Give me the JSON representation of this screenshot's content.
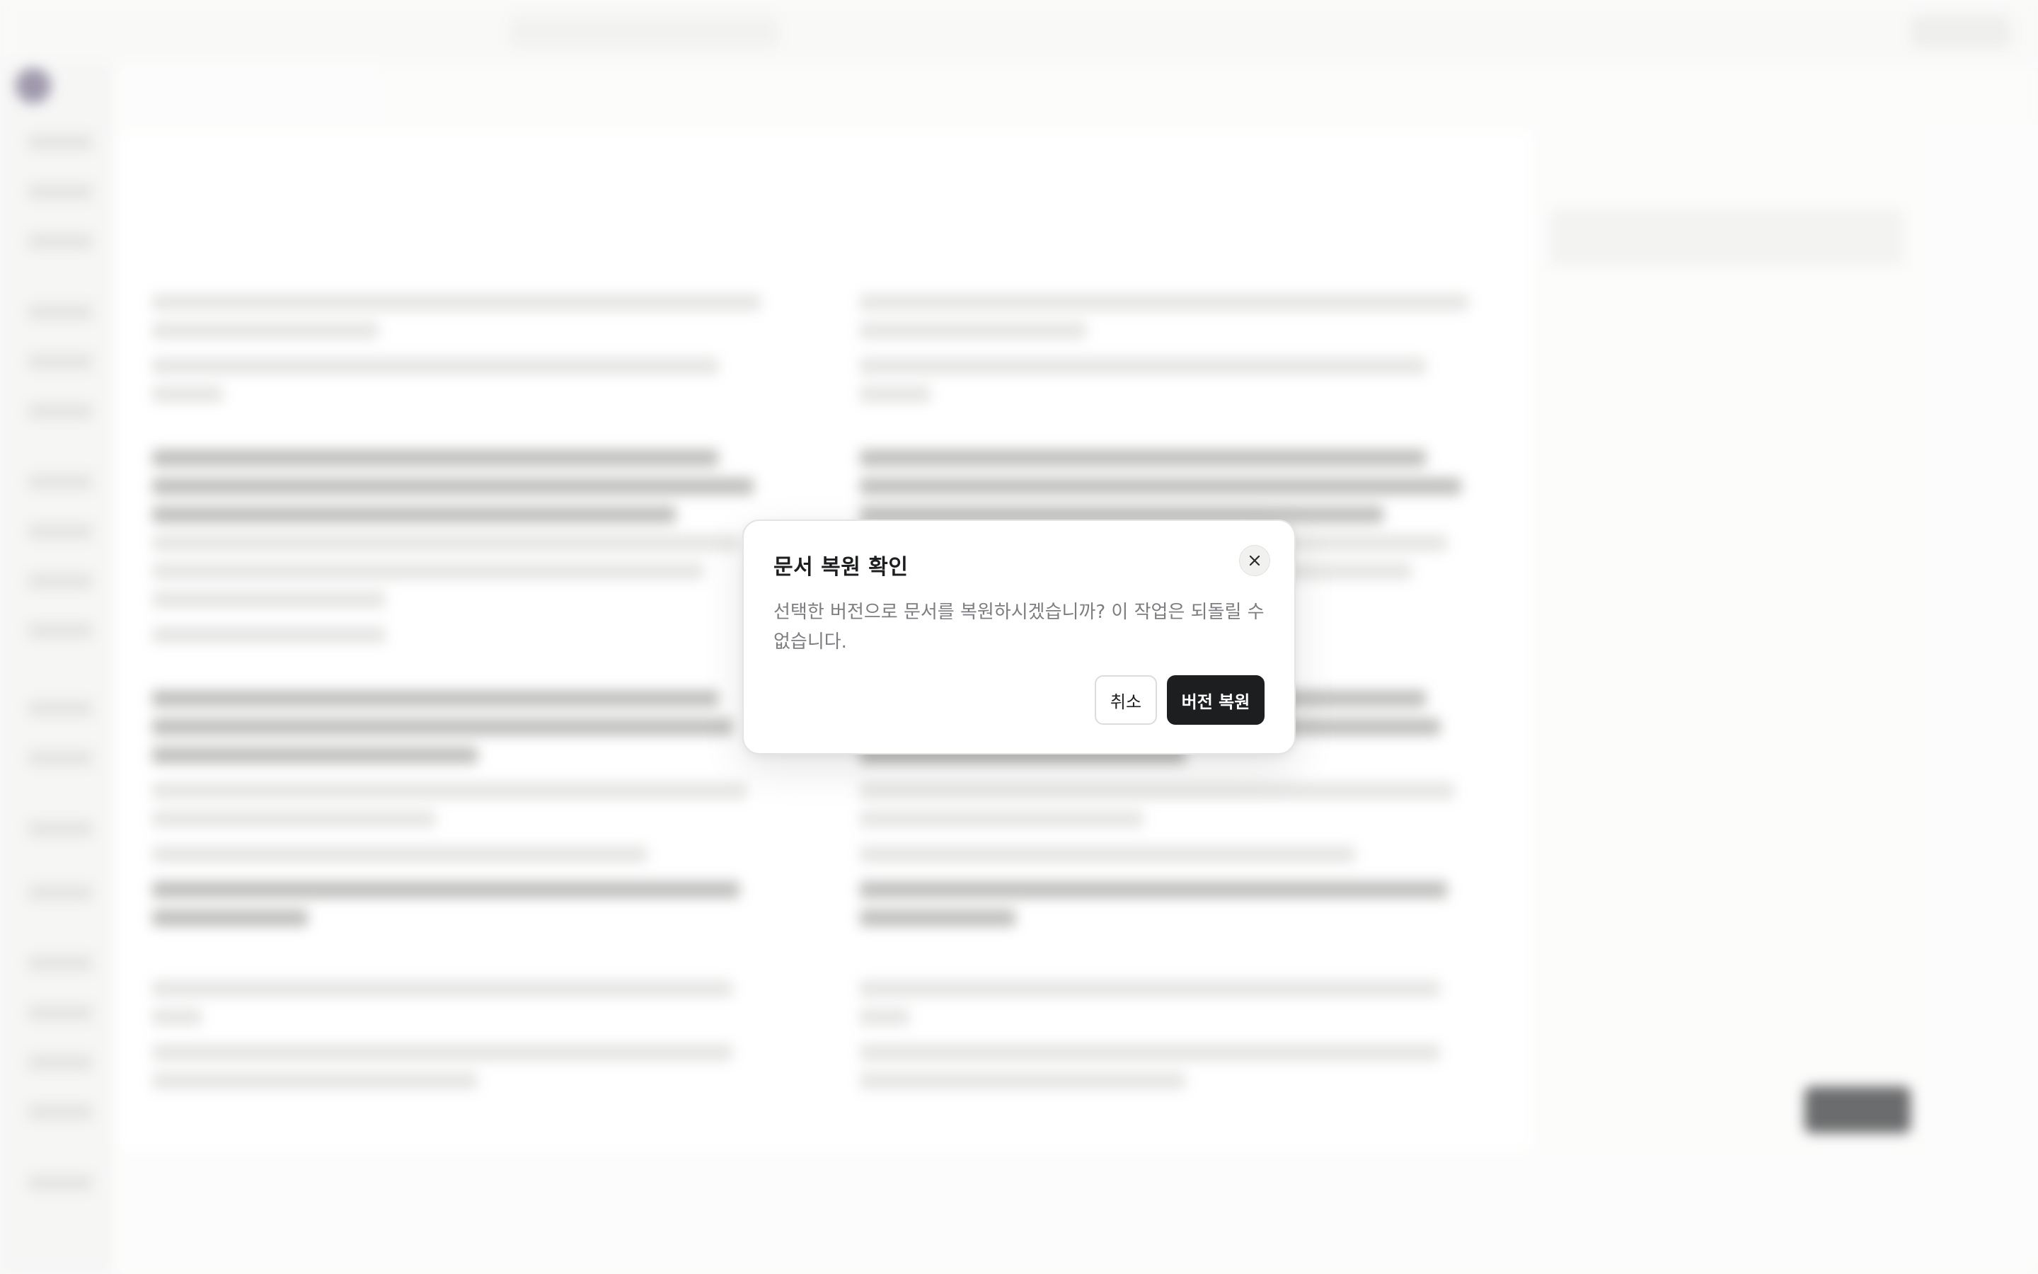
{
  "dialog": {
    "title": "문서 복원 확인",
    "message": "선택한 버전으로 문서를 복원하시겠습니까? 이 작업은 되돌릴 수 없습니다.",
    "cancel_label": "취소",
    "confirm_label": "버전 복원",
    "close_icon": "close-icon"
  }
}
